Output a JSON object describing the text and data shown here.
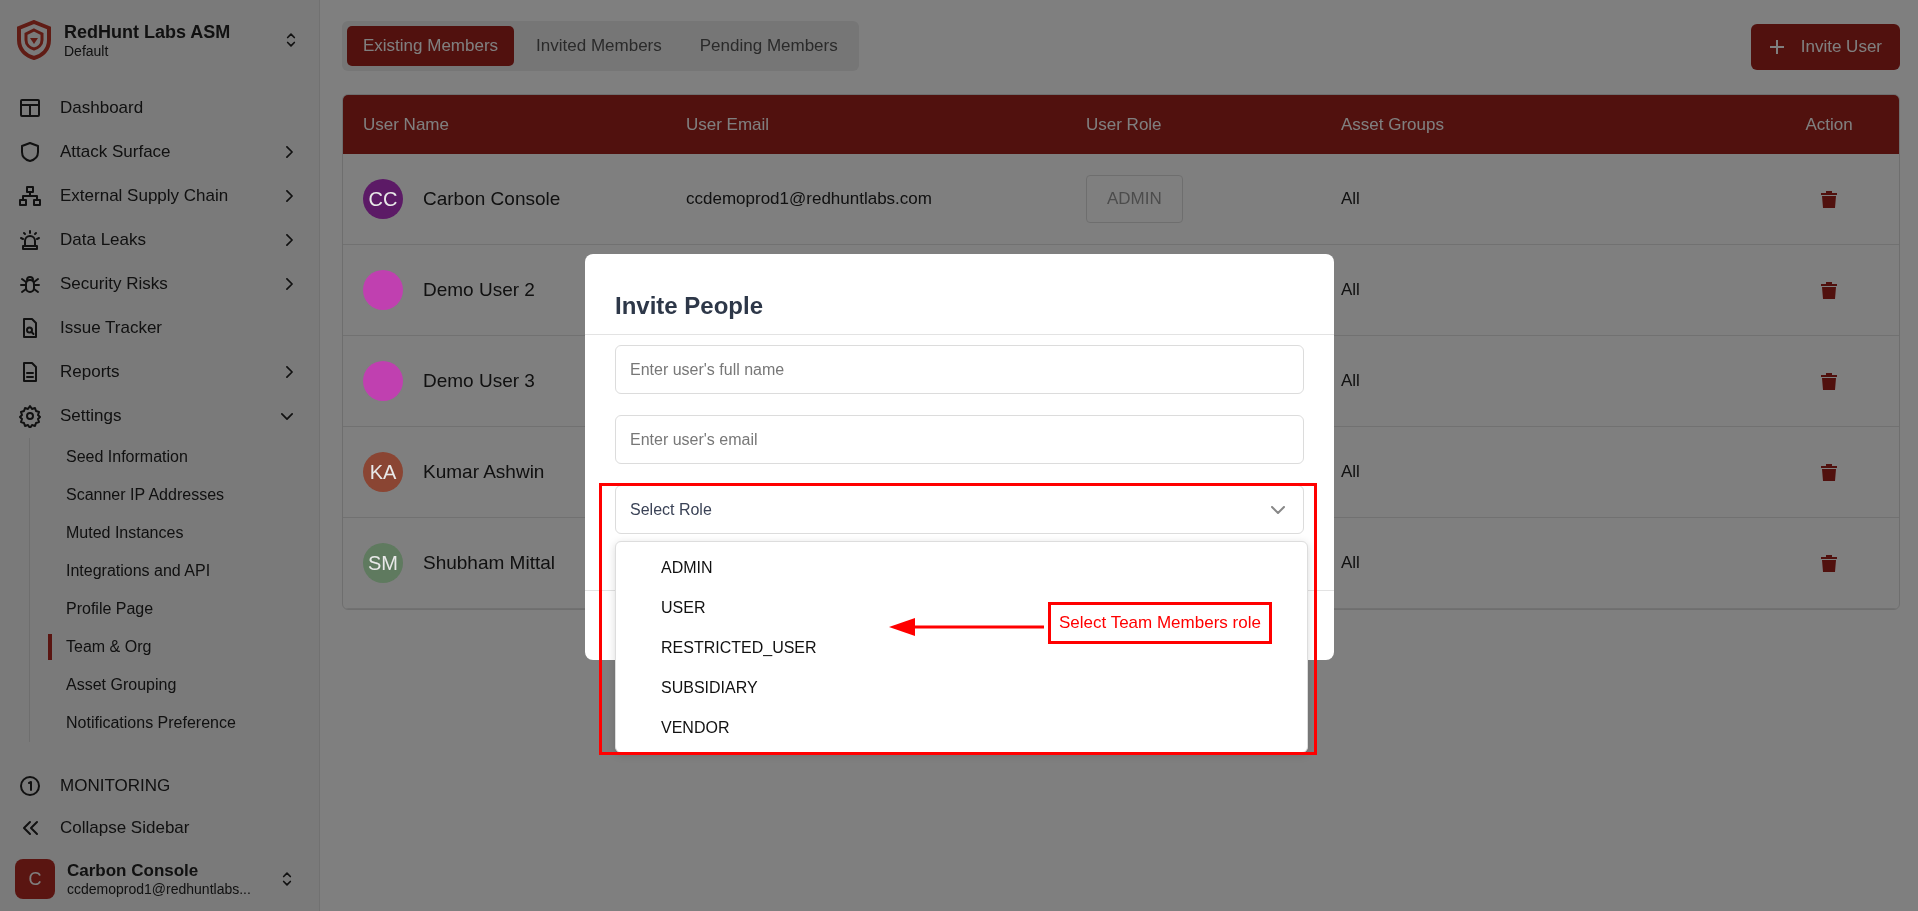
{
  "sidebar": {
    "org": {
      "name": "RedHunt Labs ASM",
      "workspace": "Default"
    },
    "nav": [
      {
        "label": "Dashboard",
        "kind": "link"
      },
      {
        "label": "Attack Surface",
        "kind": "group",
        "expanded": false
      },
      {
        "label": "External Supply Chain",
        "kind": "group",
        "expanded": false
      },
      {
        "label": "Data Leaks",
        "kind": "group",
        "expanded": false
      },
      {
        "label": "Security Risks",
        "kind": "group",
        "expanded": false
      },
      {
        "label": "Issue Tracker",
        "kind": "link"
      },
      {
        "label": "Reports",
        "kind": "group",
        "expanded": false
      },
      {
        "label": "Settings",
        "kind": "group",
        "expanded": true,
        "children": [
          {
            "label": "Seed Information",
            "selected": false
          },
          {
            "label": "Scanner IP Addresses",
            "selected": false
          },
          {
            "label": "Muted Instances",
            "selected": false
          },
          {
            "label": "Integrations and API",
            "selected": false
          },
          {
            "label": "Profile Page",
            "selected": false
          },
          {
            "label": "Team & Org",
            "selected": true
          },
          {
            "label": "Asset Grouping",
            "selected": false
          },
          {
            "label": "Notifications Preference",
            "selected": false
          }
        ]
      }
    ],
    "monitoring": "MONITORING",
    "collapse": "Collapse Sidebar",
    "user": {
      "initial": "C",
      "name": "Carbon Console",
      "email": "ccdemoprod1@redhuntlabs..."
    }
  },
  "main": {
    "tabs": [
      {
        "label": "Existing Members",
        "selected": true
      },
      {
        "label": "Invited Members",
        "selected": false
      },
      {
        "label": "Pending Members",
        "selected": false
      }
    ],
    "invite_button": "Invite User",
    "table": {
      "columns": [
        "User Name",
        "User Email",
        "User Role",
        "Asset Groups",
        "Action"
      ],
      "rows": [
        {
          "initials": "CC",
          "color": "#5c1a66",
          "name": "Carbon Console",
          "email": "ccdemoprod1@redhuntlabs.com",
          "role": "ADMIN",
          "asset_groups": "All"
        },
        {
          "color": "#c040b0",
          "name": "Demo User 2",
          "asset_groups": "All"
        },
        {
          "color": "#c040b0",
          "name": "Demo User 3",
          "asset_groups": "All"
        },
        {
          "initials": "KA",
          "color": "#8a4533",
          "name": "Kumar Ashwin",
          "asset_groups": "All"
        },
        {
          "initials": "SM",
          "color": "#5f7a5f",
          "name": "Shubham Mittal",
          "asset_groups": "All"
        }
      ]
    }
  },
  "modal": {
    "title": "Invite People",
    "name_field": {
      "placeholder": "Enter user's full name"
    },
    "email_field": {
      "placeholder": "Enter user's email"
    },
    "role_select": {
      "placeholder": "Select Role",
      "expanded": true,
      "options": [
        {
          "label": "ADMIN",
          "selected": false
        },
        {
          "label": "USER",
          "selected": false
        },
        {
          "label": "RESTRICTED_USER",
          "selected": false
        },
        {
          "label": "SUBSIDIARY",
          "selected": false
        },
        {
          "label": "VENDOR",
          "selected": false
        }
      ]
    }
  },
  "annotation": {
    "label": "Select Team Members role"
  }
}
